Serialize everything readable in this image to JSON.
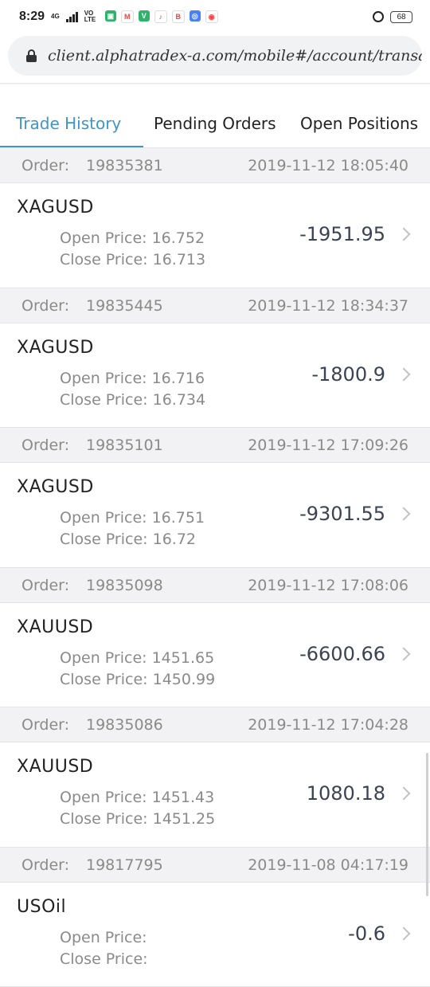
{
  "status": {
    "time": "8:29",
    "network_type": "4G",
    "volte": "VO LTE",
    "app_icons": [
      {
        "name": "shield-app-icon",
        "color": "#2fb36c",
        "glyph": "▣"
      },
      {
        "name": "gmail-icon",
        "color": "#ffffff",
        "glyph": "M"
      },
      {
        "name": "vpn-app-icon",
        "color": "#2fb36c",
        "glyph": "V"
      },
      {
        "name": "sport-app-icon",
        "color": "#ffffff",
        "glyph": "♪"
      },
      {
        "name": "bold-app-icon",
        "color": "#ffffff",
        "glyph": "B"
      },
      {
        "name": "blue-app-icon",
        "color": "#4a7ff5",
        "glyph": "◎"
      },
      {
        "name": "chrome-icon",
        "color": "#ffffff",
        "glyph": "◉"
      }
    ],
    "battery": "68"
  },
  "browser": {
    "url": "client.alphatradex-a.com/mobile#/account/transacti"
  },
  "tabs": [
    {
      "label": "Trade History",
      "active": true
    },
    {
      "label": "Pending Orders",
      "active": false
    },
    {
      "label": "Open Positions",
      "active": false
    }
  ],
  "orders": [
    {
      "order_label": "Order:",
      "order_id": "19835381",
      "datetime": "2019-11-12  18:05:40",
      "symbol": "XAGUSD",
      "open_label": "Open Price:",
      "open_price": "16.752",
      "close_label": "Close Price:",
      "close_price": "16.713",
      "pnl": "-1951.95"
    },
    {
      "order_label": "Order:",
      "order_id": "19835445",
      "datetime": "2019-11-12  18:34:37",
      "symbol": "XAGUSD",
      "open_label": "Open Price:",
      "open_price": "16.716",
      "close_label": "Close Price:",
      "close_price": "16.734",
      "pnl": "-1800.9"
    },
    {
      "order_label": "Order:",
      "order_id": "19835101",
      "datetime": "2019-11-12  17:09:26",
      "symbol": "XAGUSD",
      "open_label": "Open Price:",
      "open_price": "16.751",
      "close_label": "Close Price:",
      "close_price": "16.72",
      "pnl": "-9301.55"
    },
    {
      "order_label": "Order:",
      "order_id": "19835098",
      "datetime": "2019-11-12  17:08:06",
      "symbol": "XAUUSD",
      "open_label": "Open Price:",
      "open_price": "1451.65",
      "close_label": "Close Price:",
      "close_price": "1450.99",
      "pnl": "-6600.66"
    },
    {
      "order_label": "Order:",
      "order_id": "19835086",
      "datetime": "2019-11-12  17:04:28",
      "symbol": "XAUUSD",
      "open_label": "Open Price:",
      "open_price": "1451.43",
      "close_label": "Close Price:",
      "close_price": "1451.25",
      "pnl": "1080.18"
    },
    {
      "order_label": "Order:",
      "order_id": "19817795",
      "datetime": "2019-11-08  04:17:19",
      "symbol": "USOil",
      "open_label": "Open Price:",
      "open_price": "",
      "close_label": "Close Price:",
      "close_price": "",
      "pnl": "-0.6"
    }
  ],
  "colors": {
    "accent": "#3d95c8",
    "header_bg": "#f2f2f4",
    "muted_text": "#8a8a8a"
  }
}
